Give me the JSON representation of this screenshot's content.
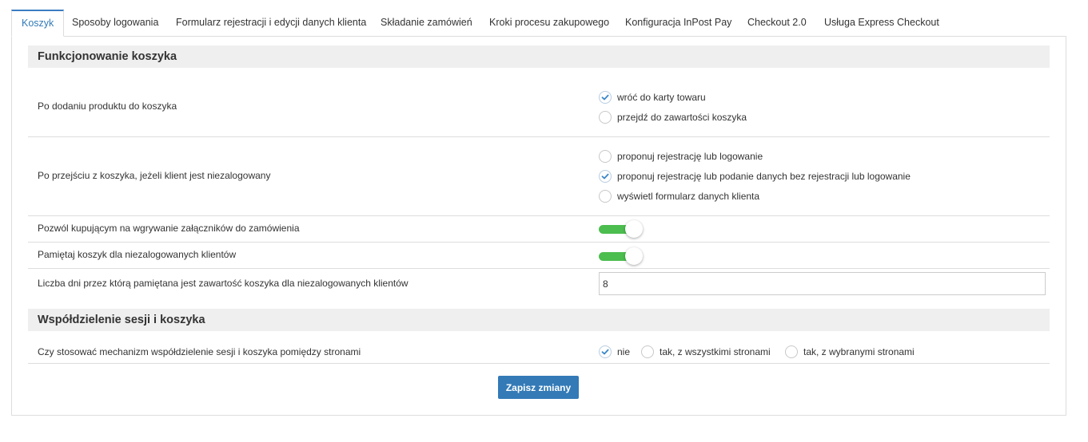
{
  "tabs": [
    {
      "label": "Koszyk",
      "active": true
    },
    {
      "label": "Sposoby logowania"
    },
    {
      "label": "Formularz rejestracji i edycji danych klienta"
    },
    {
      "label": "Składanie zamówień"
    },
    {
      "label": "Kroki procesu zakupowego"
    },
    {
      "label": "Konfiguracja InPost Pay"
    },
    {
      "label": "Checkout 2.0"
    },
    {
      "label": "Usługa Express Checkout"
    }
  ],
  "section1": {
    "title": "Funkcjonowanie koszyka",
    "after_add": {
      "label": "Po dodaniu produktu do koszyka",
      "options": [
        "wróć do karty towaru",
        "przejdź do zawartości koszyka"
      ],
      "selected": "wróć do karty towaru"
    },
    "after_leave": {
      "label": "Po przejściu z koszyka, jeżeli klient jest niezalogowany",
      "options": [
        "proponuj rejestrację lub logowanie",
        "proponuj rejestrację lub podanie danych bez rejestracji lub logowanie",
        "wyświetl formularz danych klienta"
      ],
      "selected": "proponuj rejestrację lub podanie danych bez rejestracji lub logowanie"
    },
    "attachments": {
      "label": "Pozwól kupującym na wgrywanie załączników do zamówienia",
      "enabled": true
    },
    "remember_cart": {
      "label": "Pamiętaj koszyk dla niezalogowanych klientów",
      "enabled": true
    },
    "remember_days": {
      "label": "Liczba dni przez którą pamiętana jest zawartość koszyka dla niezalogowanych klientów",
      "value": "8"
    }
  },
  "section2": {
    "title": "Współdzielenie sesji i koszyka",
    "sharing": {
      "label": "Czy stosować mechanizm współdzielenie sesji i koszyka pomiędzy stronami",
      "options": [
        "nie",
        "tak, z wszystkimi stronami",
        "tak, z wybranymi stronami"
      ],
      "selected": "nie"
    }
  },
  "save_label": "Zapisz zmiany",
  "colors": {
    "accent": "#337ab7",
    "toggle_on": "#4cbd4f",
    "section_bg": "#efefef"
  }
}
